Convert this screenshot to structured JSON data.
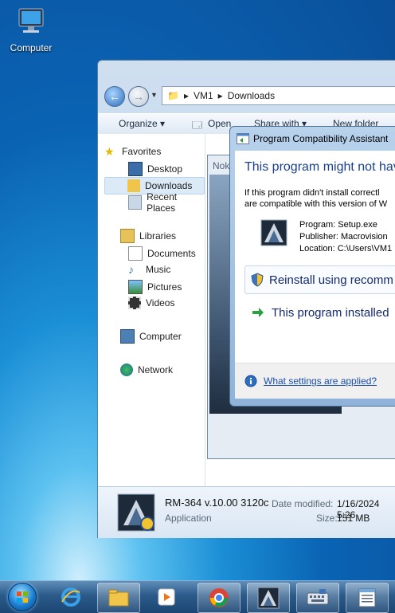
{
  "desktop": {
    "computer_icon_label": "Computer"
  },
  "explorer": {
    "breadcrumb": [
      "VM1",
      "Downloads"
    ],
    "toolbar": {
      "organize": "Organize ▾",
      "open": "Open",
      "share_with": "Share with ▾",
      "new_folder": "New folder"
    },
    "nav": {
      "favorites": "Favorites",
      "desktop": "Desktop",
      "downloads": "Downloads",
      "recent_places": "Recent Places",
      "libraries": "Libraries",
      "documents": "Documents",
      "music": "Music",
      "pictures": "Pictures",
      "videos": "Videos",
      "computer": "Computer",
      "network": "Network"
    },
    "details": {
      "name": "RM-364 v.10.00 3120c",
      "type": "Application",
      "date_label": "Date modified:",
      "date_value": "1/16/2024 5:26",
      "size_label": "Size:",
      "size_value": "151 MB"
    }
  },
  "background_window": {
    "title": "Nok"
  },
  "pca": {
    "title": "Program Compatibility Assistant",
    "heading": "This program might not hav",
    "message_line1": "If this program didn't install correctl",
    "message_line2": "are compatible with this version of W",
    "program": "Program: Setup.exe",
    "publisher": "Publisher: Macrovision",
    "location": "Location: C:\\Users\\VM1",
    "reinstall": "Reinstall using recomm",
    "installed": "This program installed",
    "settings_link": "What settings are applied?"
  }
}
